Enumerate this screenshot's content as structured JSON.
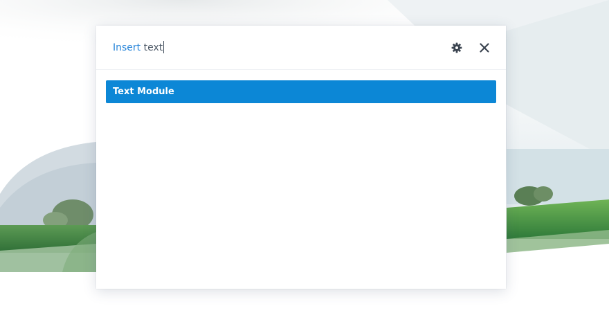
{
  "search": {
    "prefix": "Insert",
    "value": "text"
  },
  "header": {
    "settings_icon": "gear-icon",
    "close_icon": "close-icon"
  },
  "results": [
    {
      "label": "Text Module",
      "highlighted": true
    }
  ],
  "colors": {
    "accent": "#2b87da",
    "highlight": "#0c87d6",
    "grass": "#3e8e3e"
  }
}
